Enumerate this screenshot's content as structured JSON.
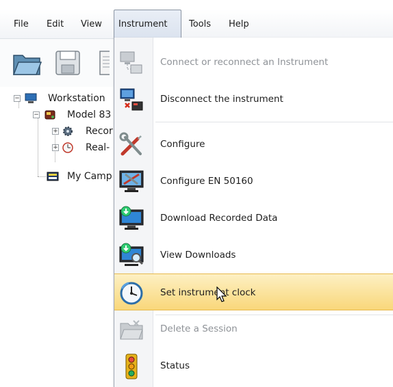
{
  "menubar": {
    "items": [
      {
        "label": "File"
      },
      {
        "label": "Edit"
      },
      {
        "label": "View"
      },
      {
        "label": "Instrument"
      },
      {
        "label": "Tools"
      },
      {
        "label": "Help"
      }
    ]
  },
  "toolbar": {
    "buttons": [
      {
        "icon": "open-folder-icon"
      },
      {
        "icon": "save-disk-icon"
      },
      {
        "icon": "document-icon"
      }
    ]
  },
  "tree": {
    "workstation": "Workstation",
    "model": "Model 83",
    "recorded": "Recor",
    "realtime": "Real-",
    "campaign": "My Camp"
  },
  "dropdown": {
    "items": [
      {
        "label": "Connect or reconnect an Instrument",
        "enabled": false,
        "icon": "connect-computer-icon"
      },
      {
        "label": "Disconnect the instrument",
        "enabled": true,
        "icon": "disconnect-computer-icon"
      },
      {
        "label": "Configure",
        "enabled": true,
        "icon": "configure-tools-icon"
      },
      {
        "label": "Configure EN 50160",
        "enabled": true,
        "icon": "configure-monitor-icon"
      },
      {
        "label": "Download Recorded Data",
        "enabled": true,
        "icon": "download-monitor-icon"
      },
      {
        "label": "View Downloads",
        "enabled": true,
        "icon": "view-downloads-icon"
      },
      {
        "label": "Set instrument clock",
        "enabled": true,
        "highlighted": true,
        "icon": "clock-icon"
      },
      {
        "label": "Delete a Session",
        "enabled": false,
        "icon": "delete-folder-icon"
      },
      {
        "label": "Status",
        "enabled": true,
        "icon": "traffic-light-icon"
      }
    ]
  },
  "colors": {
    "highlight_top": "#fdf0c3",
    "highlight_bottom": "#f9d77a",
    "highlight_border": "#e7b94d",
    "disabled_text": "#8e9297"
  }
}
